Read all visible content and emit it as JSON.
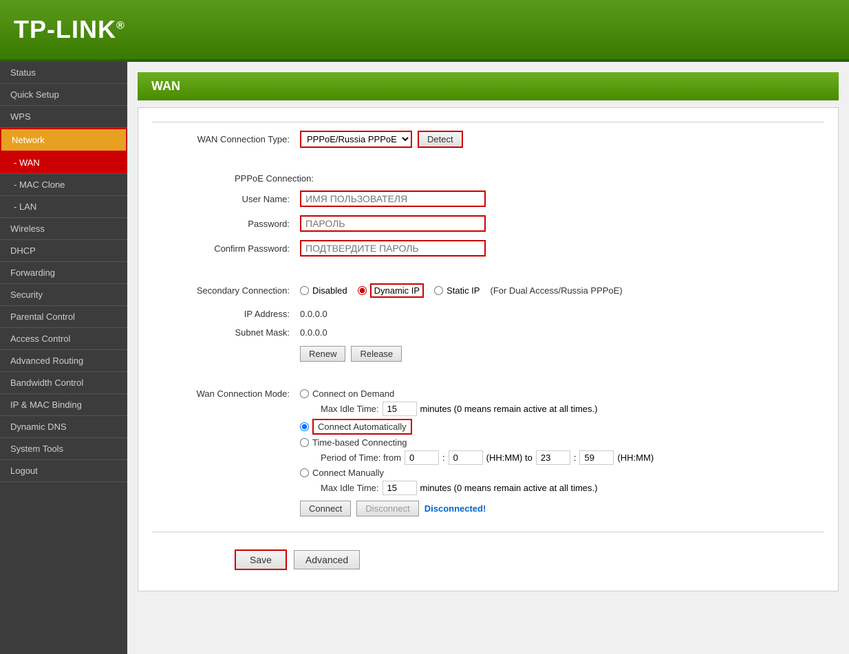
{
  "header": {
    "logo": "TP-LINK",
    "logo_registered": "®"
  },
  "sidebar": {
    "items": [
      {
        "id": "status",
        "label": "Status",
        "level": "top"
      },
      {
        "id": "quick-setup",
        "label": "Quick Setup",
        "level": "top"
      },
      {
        "id": "wps",
        "label": "WPS",
        "level": "top"
      },
      {
        "id": "network",
        "label": "Network",
        "level": "top",
        "state": "parent-active"
      },
      {
        "id": "wan",
        "label": "- WAN",
        "level": "sub",
        "state": "active"
      },
      {
        "id": "mac-clone",
        "label": "- MAC Clone",
        "level": "sub"
      },
      {
        "id": "lan",
        "label": "- LAN",
        "level": "sub"
      },
      {
        "id": "wireless",
        "label": "Wireless",
        "level": "top"
      },
      {
        "id": "dhcp",
        "label": "DHCP",
        "level": "top"
      },
      {
        "id": "forwarding",
        "label": "Forwarding",
        "level": "top"
      },
      {
        "id": "security",
        "label": "Security",
        "level": "top"
      },
      {
        "id": "parental-control",
        "label": "Parental Control",
        "level": "top"
      },
      {
        "id": "access-control",
        "label": "Access Control",
        "level": "top"
      },
      {
        "id": "advanced-routing",
        "label": "Advanced Routing",
        "level": "top"
      },
      {
        "id": "bandwidth-control",
        "label": "Bandwidth Control",
        "level": "top"
      },
      {
        "id": "ip-mac-binding",
        "label": "IP & MAC Binding",
        "level": "top"
      },
      {
        "id": "dynamic-dns",
        "label": "Dynamic DNS",
        "level": "top"
      },
      {
        "id": "system-tools",
        "label": "System Tools",
        "level": "top"
      },
      {
        "id": "logout",
        "label": "Logout",
        "level": "top"
      }
    ]
  },
  "page": {
    "title": "WAN",
    "wan_connection_type_label": "WAN Connection Type:",
    "wan_connection_type_value": "PPPoE/Russia PPPoE",
    "detect_button": "Detect",
    "pppoe_section_label": "PPPoE Connection:",
    "username_label": "User Name:",
    "username_placeholder": "ИМЯ ПОЛЬЗОВАТЕЛЯ",
    "password_label": "Password:",
    "password_placeholder": "ПАРОЛЬ",
    "confirm_password_label": "Confirm Password:",
    "confirm_password_placeholder": "ПОДТВЕРДИТЕ ПАРОЛЬ",
    "secondary_connection_label": "Secondary Connection:",
    "sc_disabled": "Disabled",
    "sc_dynamic_ip": "Dynamic IP",
    "sc_static_ip": "Static IP",
    "sc_note": "(For Dual Access/Russia PPPoE)",
    "ip_address_label": "IP Address:",
    "ip_address_value": "0.0.0.0",
    "subnet_mask_label": "Subnet Mask:",
    "subnet_mask_value": "0.0.0.0",
    "renew_button": "Renew",
    "release_button": "Release",
    "wan_connection_mode_label": "Wan Connection Mode:",
    "connect_on_demand": "Connect on Demand",
    "max_idle_time_label": "Max Idle Time:",
    "max_idle_time_value1": "15",
    "max_idle_note1": "minutes (0 means remain active at all times.)",
    "connect_automatically": "Connect Automatically",
    "time_based_connecting": "Time-based Connecting",
    "period_of_time_label": "Period of Time: from",
    "time_from_h": "0",
    "time_from_m": "0",
    "time_hhmm1": "(HH:MM) to",
    "time_to_h": "23",
    "time_to_m": "59",
    "time_hhmm2": "(HH:MM)",
    "connect_manually": "Connect Manually",
    "max_idle_time_value2": "15",
    "max_idle_note2": "minutes (0 means remain active at all times.)",
    "connect_button": "Connect",
    "disconnect_button": "Disconnect",
    "disconnected_status": "Disconnected!",
    "save_button": "Save",
    "advanced_button": "Advanced"
  }
}
